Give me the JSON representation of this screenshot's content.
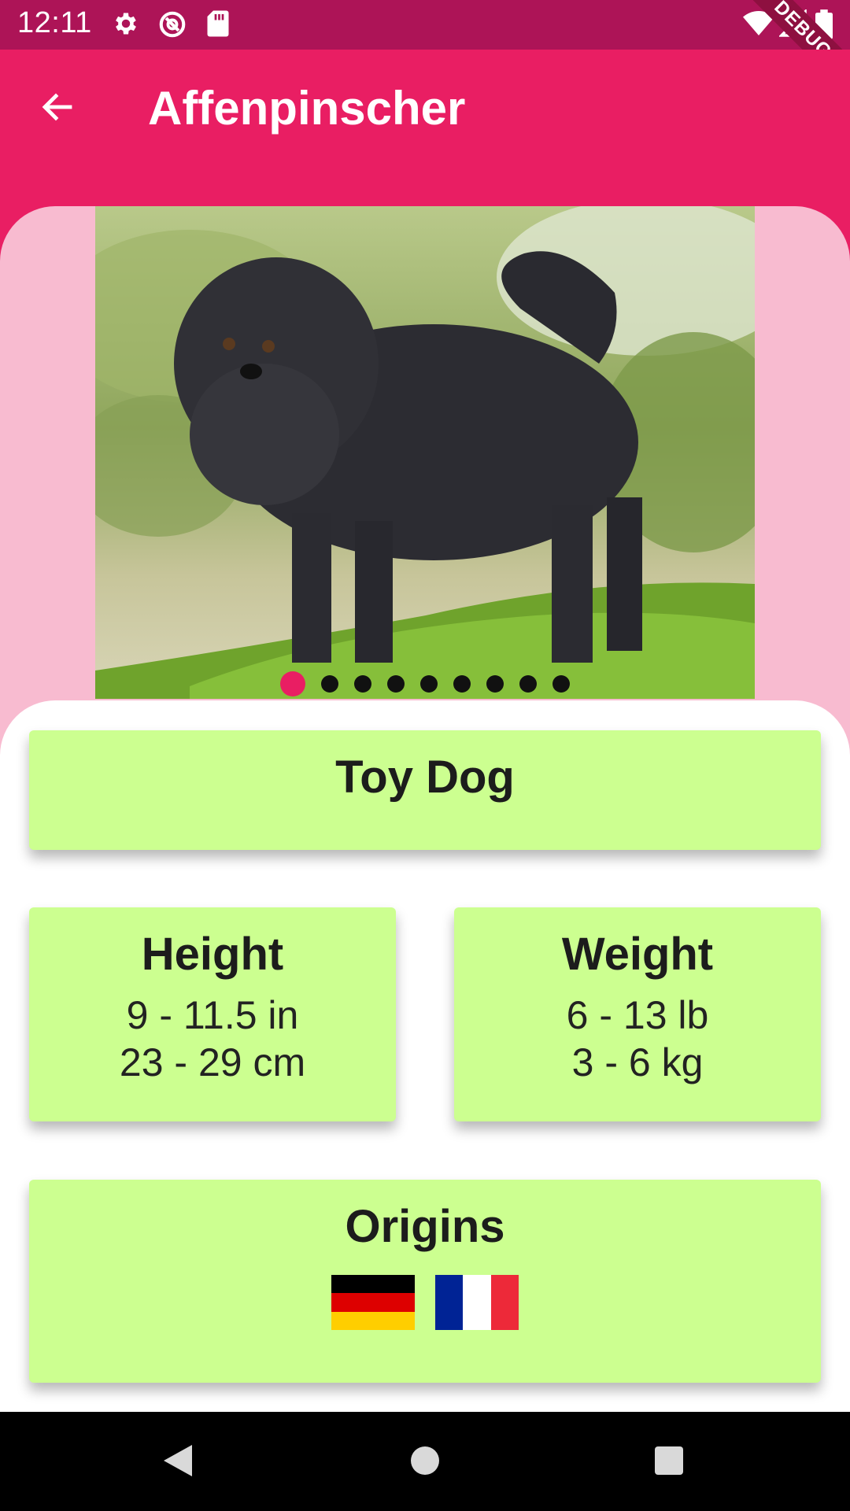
{
  "status_bar": {
    "time": "12:11",
    "icons": [
      "settings-icon",
      "data-saver-icon",
      "sd-card-icon",
      "wifi-icon",
      "signal-icon",
      "battery-icon"
    ],
    "debug_label": "DEBUG"
  },
  "app_bar": {
    "title": "Affenpinscher",
    "back_icon": "arrow-back-icon"
  },
  "carousel": {
    "image": "dog-photo",
    "page_count": 9,
    "current_page": 1
  },
  "cards": {
    "group": {
      "title": "Toy Dog"
    },
    "height": {
      "title": "Height",
      "imperial": "9 - 11.5 in",
      "metric": "23 - 29 cm"
    },
    "weight": {
      "title": "Weight",
      "imperial": "6 - 13 lb",
      "metric": "3 - 6 kg"
    },
    "origins": {
      "title": "Origins",
      "flags": [
        "germany-flag",
        "france-flag"
      ]
    }
  },
  "nav_bar": {
    "buttons": [
      "back-triangle-icon",
      "home-circle-icon",
      "recents-square-icon"
    ]
  },
  "colors": {
    "status_bar": "#AD1457",
    "primary": "#E91E63",
    "carousel_bg": "#F8BBD0",
    "card": "#CCFF90",
    "dot_active": "#E91E63",
    "dot": "#111111"
  }
}
